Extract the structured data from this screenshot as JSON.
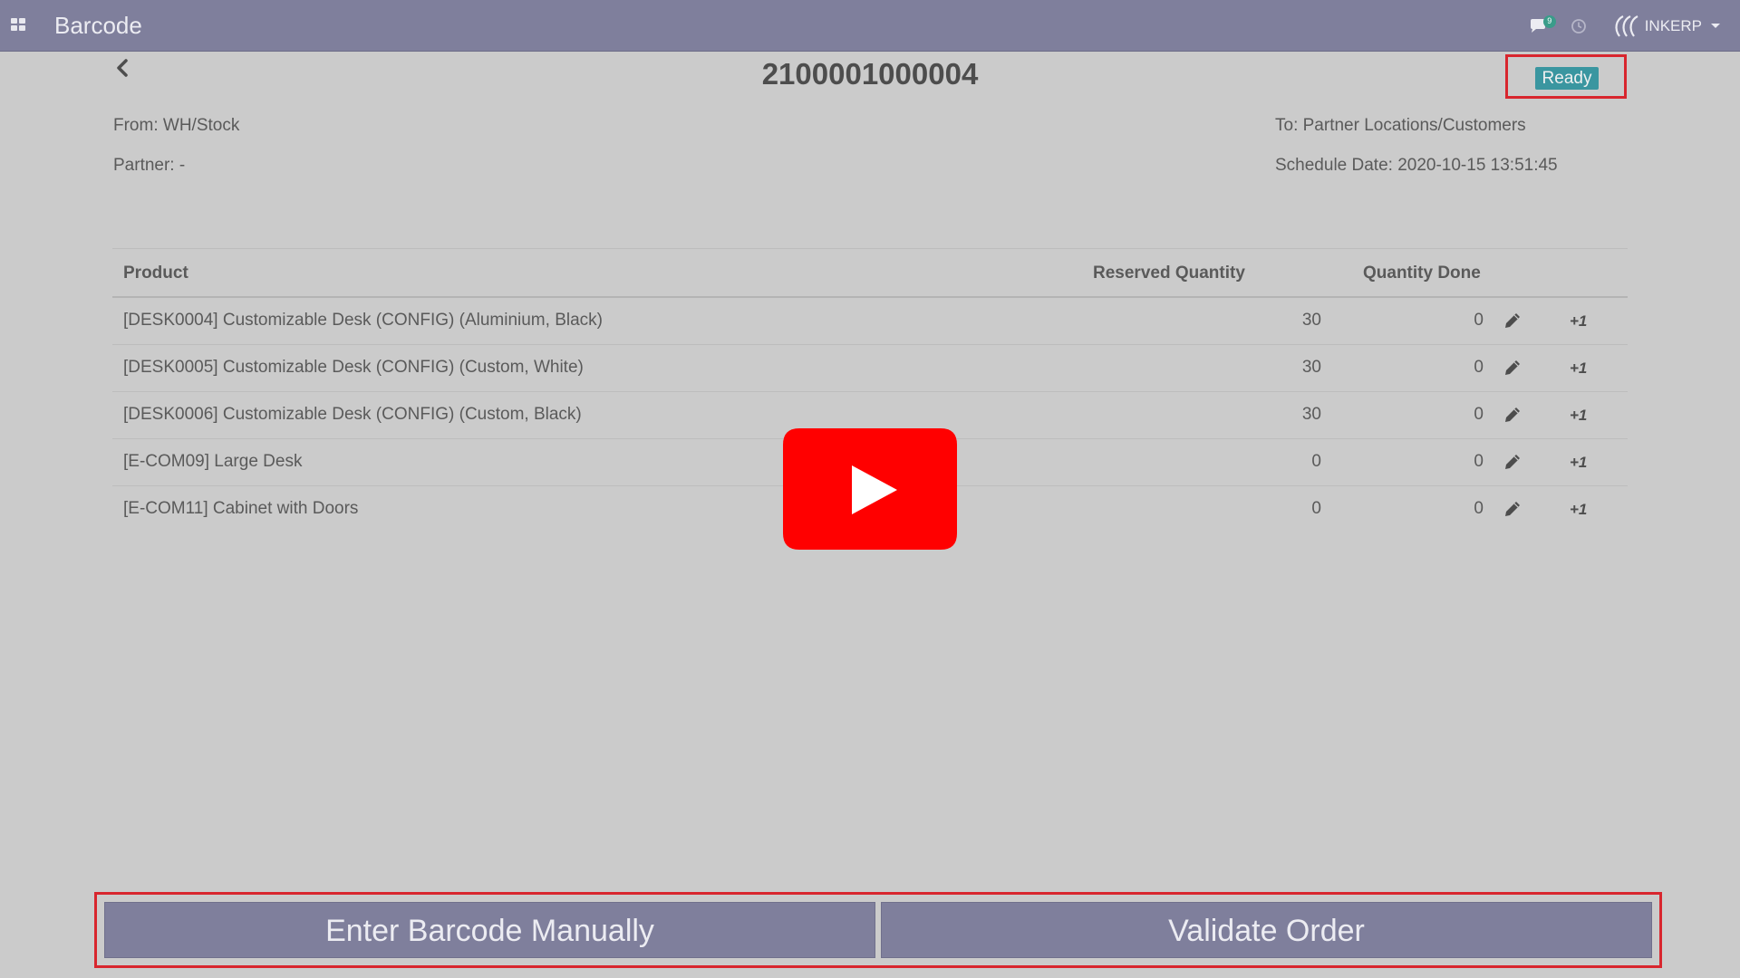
{
  "navbar": {
    "app_title": "Barcode",
    "chat_count": "9",
    "user_name": "INKERP",
    "icons": [
      "apps-grid-icon",
      "chat-icon",
      "clock-icon",
      "inkerp-logo-icon",
      "caret-down-icon"
    ]
  },
  "picking": {
    "title": "2100001000004",
    "status": "Ready",
    "from": "From: WH/Stock",
    "partner": "Partner: -",
    "to": "To: Partner Locations/Customers",
    "schedule_date": "Schedule Date: 2020-10-15 13:51:45"
  },
  "table": {
    "headers": {
      "product": "Product",
      "reserved": "Reserved Quantity",
      "done": "Quantity Done"
    },
    "rows": [
      {
        "product": "[DESK0004] Customizable Desk (CONFIG) (Aluminium, Black)",
        "reserved": "30",
        "done": "0",
        "increment": "+1"
      },
      {
        "product": "[DESK0005] Customizable Desk (CONFIG) (Custom, White)",
        "reserved": "30",
        "done": "0",
        "increment": "+1"
      },
      {
        "product": "[DESK0006] Customizable Desk (CONFIG) (Custom, Black)",
        "reserved": "30",
        "done": "0",
        "increment": "+1"
      },
      {
        "product": "[E-COM09] Large Desk",
        "reserved": "0",
        "done": "0",
        "increment": "+1"
      },
      {
        "product": "[E-COM11] Cabinet with Doors",
        "reserved": "0",
        "done": "0",
        "increment": "+1"
      }
    ]
  },
  "actions": {
    "enter_barcode": "Enter Barcode Manually",
    "validate": "Validate Order"
  },
  "colors": {
    "navbar": "#7f7f9c",
    "background": "#cbcbcb",
    "status_badge": "#3a96a0",
    "highlight": "#d8262e",
    "play_button": "#ff0000"
  }
}
